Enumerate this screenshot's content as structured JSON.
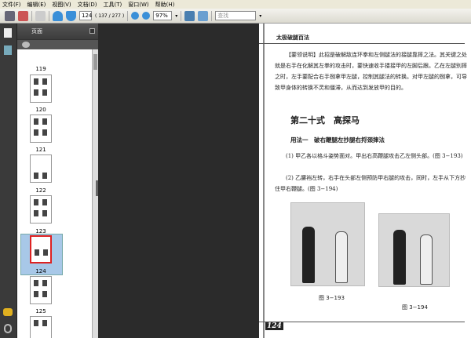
{
  "menu": [
    "文件(F)",
    "编辑(E)",
    "视图(V)",
    "文档(D)",
    "工具(T)",
    "窗口(W)",
    "帮助(H)"
  ],
  "toolbar": {
    "page_number": "124",
    "page_count": "( 137 / 277 )",
    "zoom": "97%",
    "search_placeholder": "查找"
  },
  "nav": {
    "title": "页面",
    "thumbnails": [
      "119",
      "120",
      "121",
      "122",
      "123",
      "124",
      "125"
    ],
    "selected": "124"
  },
  "page": {
    "header": "太极破腿百法",
    "para1": "【要领说明】此招是破解敌连环拳和左侧腿法的接腿靠摔之法。其关键之处就是右手在化解其左拳的攻击时，要快速收手搂接甲的左脚后跟。乙在左腿别摔之时，左手要配合右手捌拿甲左腿，控制其腿法的转换。对甲左腿的捌拿，可导致甲身体的转换不灵和僵滞，从而达到发放甲的目的。",
    "section_title": "第二十式　高探马",
    "subtitle": "用法一　破右鞭腿左抄腿右捋颈摔法",
    "step1": "(1) 甲乙各以格斗姿势面对。甲出右高鞭腿攻击乙左侧头部。(图 3−193)",
    "step2": "(2) 乙腰裆左转，右手在头部左侧预防甲右腿的攻击，同时，左手从下方抄住甲右鞭腿。(图 3−194)",
    "fig1": "图 3−193",
    "fig2": "图 3−194",
    "page_no": "124"
  }
}
